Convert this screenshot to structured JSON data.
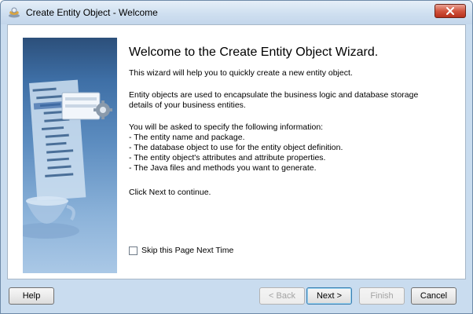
{
  "window": {
    "title": "Create Entity Object - Welcome",
    "title_icon": "wizard-app-icon",
    "close_icon": "close-icon"
  },
  "side_image": {
    "description_icon": "wizard-illustration"
  },
  "main": {
    "heading": "Welcome to the Create Entity Object Wizard.",
    "intro": "This wizard will help you to quickly create a new entity object.",
    "para1_line1": "Entity objects are used to encapsulate the business logic and database storage",
    "para1_line2": "details of your business entities.",
    "info_intro": "You will be asked to specify the following information:",
    "info_items": [
      "- The entity name and package.",
      "- The database object to use for the entity object definition.",
      "- The entity object's attributes and attribute properties.",
      "- The Java files and methods you want to generate."
    ],
    "click_next": "Click Next to continue.",
    "skip_label": "Skip this Page Next Time",
    "skip_checked": false
  },
  "buttons": {
    "help": "Help",
    "back": "< Back",
    "next": "Next >",
    "finish": "Finish",
    "cancel": "Cancel"
  },
  "colors": {
    "window_bg": "#c9dcef",
    "close_red": "#c9452f",
    "default_button_border": "#3c7fb1"
  }
}
